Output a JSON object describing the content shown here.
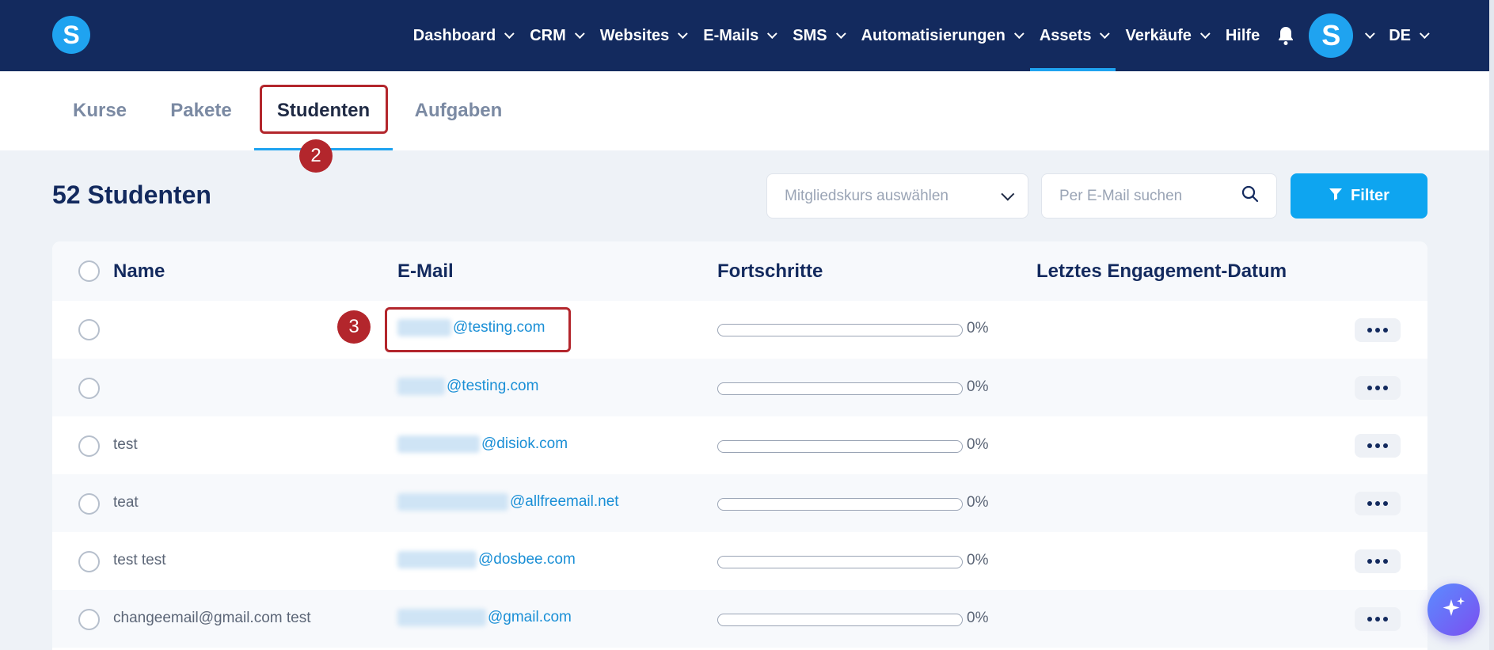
{
  "nav": {
    "logo_letter": "S",
    "items": [
      {
        "label": "Dashboard",
        "dropdown": true
      },
      {
        "label": "CRM",
        "dropdown": true
      },
      {
        "label": "Websites",
        "dropdown": true
      },
      {
        "label": "E-Mails",
        "dropdown": true
      },
      {
        "label": "SMS",
        "dropdown": true
      },
      {
        "label": "Automatisierungen",
        "dropdown": true
      },
      {
        "label": "Assets",
        "dropdown": true,
        "active": true
      },
      {
        "label": "Verkäufe",
        "dropdown": true
      },
      {
        "label": "Hilfe",
        "dropdown": false
      }
    ],
    "avatar_letter": "S",
    "language": "DE"
  },
  "tabs": [
    {
      "label": "Kurse"
    },
    {
      "label": "Pakete"
    },
    {
      "label": "Studenten",
      "active": true
    },
    {
      "label": "Aufgaben"
    }
  ],
  "annotations": {
    "marker_tab": "2",
    "marker_email": "3"
  },
  "page": {
    "title": "52 Studenten",
    "course_select_placeholder": "Mitgliedskurs auswählen",
    "search_placeholder": "Per E-Mail suchen",
    "filter_label": "Filter"
  },
  "table": {
    "headers": {
      "name": "Name",
      "email": "E-Mail",
      "progress": "Fortschritte",
      "last_engagement": "Letztes Engagement-Datum"
    },
    "rows": [
      {
        "name": "",
        "email_domain": "@testing.com",
        "progress": 0,
        "progress_label": "0%",
        "last_engagement": ""
      },
      {
        "name": "",
        "email_domain": "@testing.com",
        "progress": 0,
        "progress_label": "0%",
        "last_engagement": ""
      },
      {
        "name": "test",
        "email_domain": "@disiok.com",
        "progress": 0,
        "progress_label": "0%",
        "last_engagement": ""
      },
      {
        "name": "teat",
        "email_domain": "@allfreemail.net",
        "progress": 0,
        "progress_label": "0%",
        "last_engagement": ""
      },
      {
        "name": "test test",
        "email_domain": "@dosbee.com",
        "progress": 0,
        "progress_label": "0%",
        "last_engagement": ""
      },
      {
        "name": "changeemail@gmail.com test",
        "email_domain": "@gmail.com",
        "progress": 0,
        "progress_label": "0%",
        "last_engagement": ""
      }
    ]
  },
  "colors": {
    "nav_bg": "#132a5e",
    "accent": "#1fa3f0",
    "annotation": "#b3262c"
  }
}
